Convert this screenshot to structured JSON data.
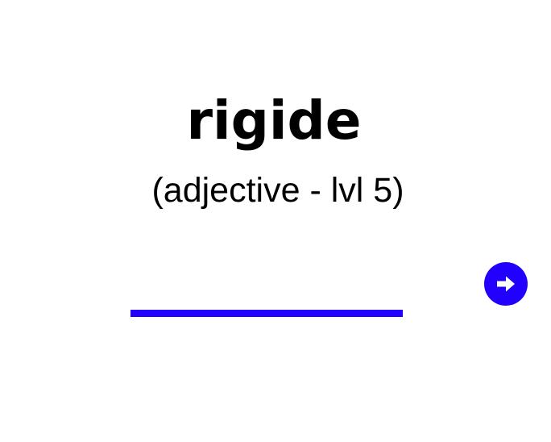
{
  "card": {
    "word": "rigide",
    "part_of_speech": "(adjective - lvl 5)"
  },
  "answer": {
    "value": "",
    "placeholder": ""
  },
  "next_button": {
    "icon": "arrow-right-icon",
    "color": "#2200ff"
  }
}
